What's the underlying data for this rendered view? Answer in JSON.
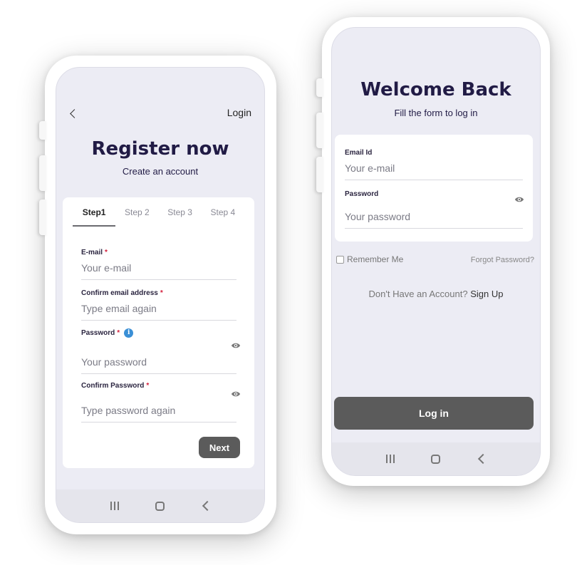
{
  "register": {
    "back_icon": "chevron-left-icon",
    "login_link": "Login",
    "title": "Register now",
    "subtitle": "Create an account",
    "tabs": [
      "Step1",
      "Step 2",
      "Step 3",
      "Step 4"
    ],
    "active_tab": "Step1",
    "fields": {
      "email": {
        "label": "E-mail",
        "required": "*",
        "placeholder": "Your e-mail"
      },
      "confirm_email": {
        "label": "Confirm email address",
        "required": "*",
        "placeholder": "Type email again"
      },
      "password": {
        "label": "Password",
        "required": "*",
        "info_icon": "i",
        "placeholder": "Your password"
      },
      "confirm_password": {
        "label": "Confirm Password",
        "required": "*",
        "placeholder": "Type password again"
      }
    },
    "next_label": "Next"
  },
  "login": {
    "title": "Welcome Back",
    "subtitle": "Fill the form to log in",
    "fields": {
      "email": {
        "label": "Email Id",
        "placeholder": "Your e-mail"
      },
      "password": {
        "label": "Password",
        "placeholder": "Your password"
      }
    },
    "remember_label": "Remember Me",
    "forgot_label": "Forgot Password?",
    "no_account_text": "Don't Have an Account?",
    "sign_up_label": "Sign Up",
    "login_button_label": "Log in"
  },
  "colors": {
    "screen_bg": "#ececf4",
    "title": "#211b45",
    "button": "#5b5b5b",
    "required": "#d31d3a",
    "info": "#3a8fd6"
  }
}
